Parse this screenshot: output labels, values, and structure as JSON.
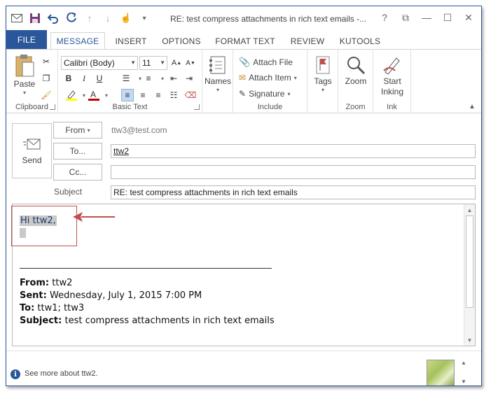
{
  "window": {
    "title": "RE: test compress attachments in rich text emails -...",
    "controls": [
      "?",
      "⧉",
      "—",
      "☐",
      "✕"
    ]
  },
  "tabs": [
    "FILE",
    "MESSAGE",
    "INSERT",
    "OPTIONS",
    "FORMAT TEXT",
    "REVIEW",
    "KUTOOLS"
  ],
  "ribbon": {
    "clipboard": {
      "label": "Clipboard",
      "paste": "Paste"
    },
    "basic_text": {
      "label": "Basic Text",
      "font": "Calibri (Body)",
      "size": "11",
      "bold": "B",
      "italic": "I",
      "underline": "U"
    },
    "names": {
      "label": "Names"
    },
    "include": {
      "label": "Include",
      "attach_file": "Attach File",
      "attach_item": "Attach Item",
      "signature": "Signature"
    },
    "tags": {
      "label": "Tags"
    },
    "zoom": {
      "label": "Zoom",
      "button": "Zoom"
    },
    "ink": {
      "label": "Ink",
      "button_line1": "Start",
      "button_line2": "Inking"
    }
  },
  "compose": {
    "send": "Send",
    "from_button": "From",
    "from_value": "ttw3@test.com",
    "to_button": "To...",
    "to_value": "ttw2",
    "cc_button": "Cc...",
    "cc_value": "",
    "subject_label": "Subject",
    "subject_value": "RE: test compress attachments in rich text emails"
  },
  "body": {
    "greeting": "Hi ttw2,",
    "separator": "________________________________________",
    "from_label": "From:",
    "from_value": "ttw2",
    "sent_label": "Sent:",
    "sent_value": "Wednesday, July 1, 2015 7:00 PM",
    "to_label": "To:",
    "to_value": "ttw1; ttw3",
    "subject_label": "Subject:",
    "subject_value": "test compress attachments in rich text emails"
  },
  "people_bar": {
    "see_more": "See more about ttw2."
  },
  "colors": {
    "accent": "#2b579a",
    "highlight_box": "#c0504d",
    "selection": "#c9c9c9"
  }
}
